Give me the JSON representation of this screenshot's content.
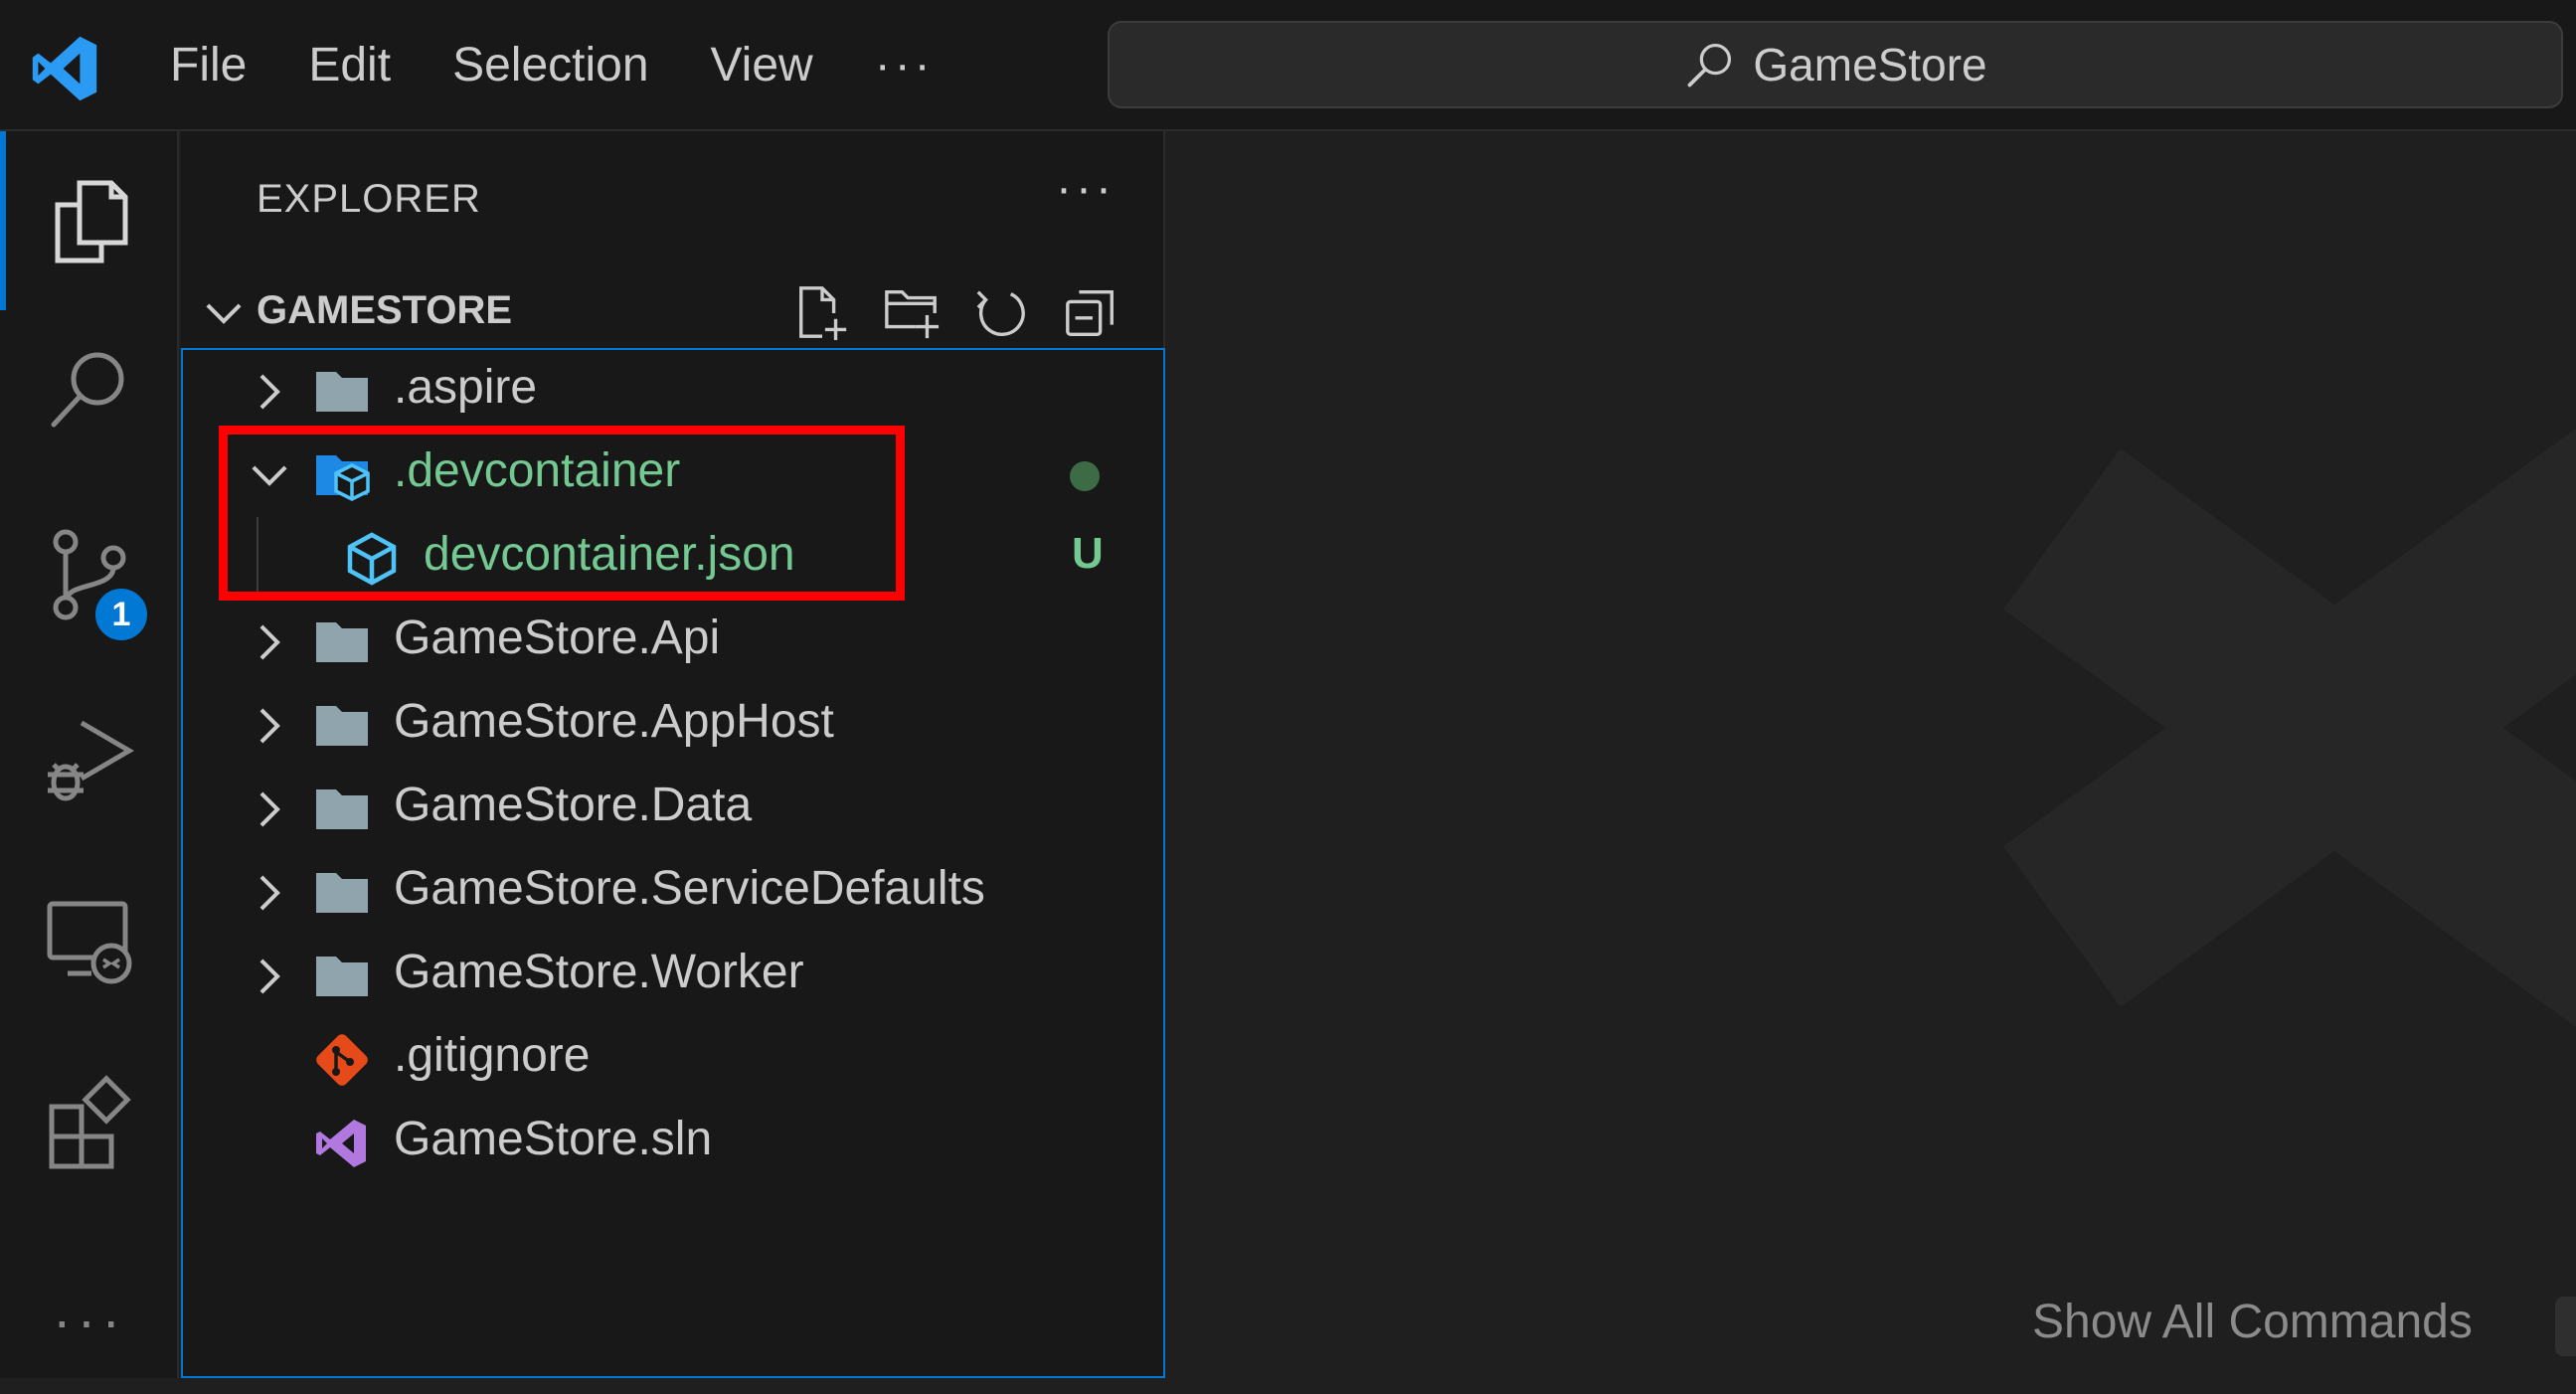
{
  "titlebar": {
    "menu": [
      "File",
      "Edit",
      "Selection",
      "View"
    ],
    "more_label": "···",
    "search_text": "GameStore"
  },
  "activitybar": {
    "items": [
      "explorer-icon",
      "search-icon",
      "source-control-icon",
      "run-debug-icon",
      "remote-explorer-icon",
      "extensions-icon"
    ],
    "source_control_badge": "1",
    "more_label": "···"
  },
  "sidebar": {
    "title": "EXPLORER",
    "more_label": "···",
    "section_title": "GAMESTORE",
    "tree": [
      {
        "label": ".aspire",
        "type": "folder",
        "expanded": false
      },
      {
        "label": ".devcontainer",
        "type": "folder",
        "expanded": true,
        "status": "dot"
      },
      {
        "label": "devcontainer.json",
        "type": "file",
        "status": "U"
      },
      {
        "label": "GameStore.Api",
        "type": "folder",
        "expanded": false
      },
      {
        "label": "GameStore.AppHost",
        "type": "folder",
        "expanded": false
      },
      {
        "label": "GameStore.Data",
        "type": "folder",
        "expanded": false
      },
      {
        "label": "GameStore.ServiceDefaults",
        "type": "folder",
        "expanded": false
      },
      {
        "label": "GameStore.Worker",
        "type": "folder",
        "expanded": false
      },
      {
        "label": ".gitignore",
        "type": "file"
      },
      {
        "label": "GameStore.sln",
        "type": "file"
      }
    ]
  },
  "editor": {
    "hint": "Show All Commands"
  },
  "colors": {
    "accent": "#0078d4",
    "untracked_green": "#73c991",
    "highlight_red": "#ff0000"
  }
}
